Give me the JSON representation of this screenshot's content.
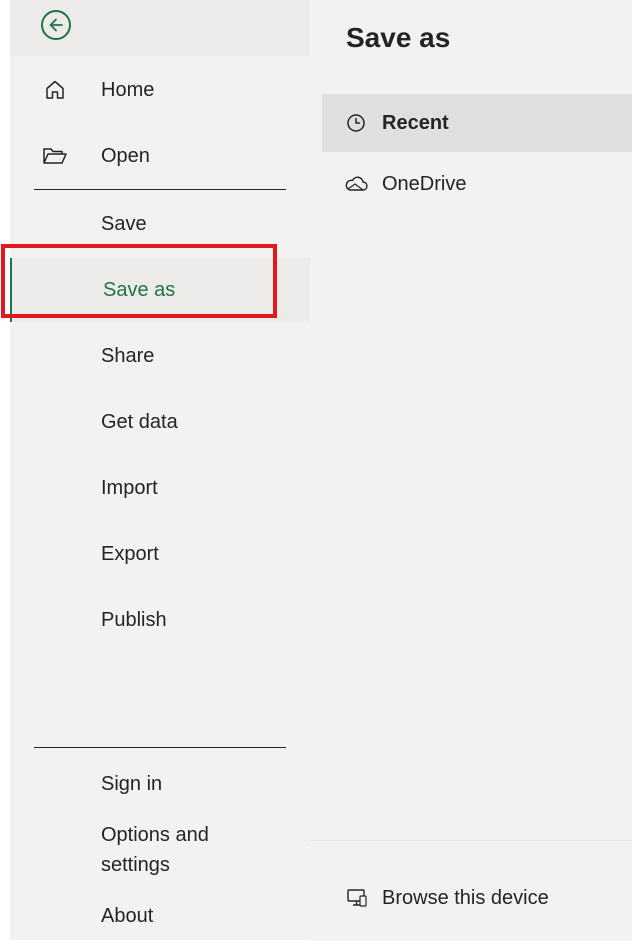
{
  "nav": {
    "back_label": "Back",
    "items": [
      {
        "id": "home",
        "label": "Home",
        "icon": "home-icon"
      },
      {
        "id": "open",
        "label": "Open",
        "icon": "folder-open-icon"
      },
      {
        "id": "save",
        "label": "Save"
      },
      {
        "id": "save-as",
        "label": "Save as",
        "selected": true
      },
      {
        "id": "share",
        "label": "Share"
      },
      {
        "id": "get-data",
        "label": "Get data"
      },
      {
        "id": "import",
        "label": "Import"
      },
      {
        "id": "export",
        "label": "Export"
      },
      {
        "id": "publish",
        "label": "Publish"
      }
    ],
    "bottom_items": [
      {
        "id": "sign-in",
        "label": "Sign in"
      },
      {
        "id": "options",
        "label_line1": "Options and",
        "label_line2": "settings"
      },
      {
        "id": "about",
        "label": "About"
      }
    ]
  },
  "content": {
    "title": "Save as",
    "locations": [
      {
        "id": "recent",
        "label": "Recent",
        "icon": "clock-icon",
        "selected": true
      },
      {
        "id": "onedrive",
        "label": "OneDrive",
        "icon": "cloud-icon"
      }
    ],
    "browse_label": "Browse this device",
    "browse_icon": "computer-icon"
  },
  "colors": {
    "accent": "#217346",
    "highlight": "#e0191e",
    "nav_bg": "#f3f2f1"
  }
}
